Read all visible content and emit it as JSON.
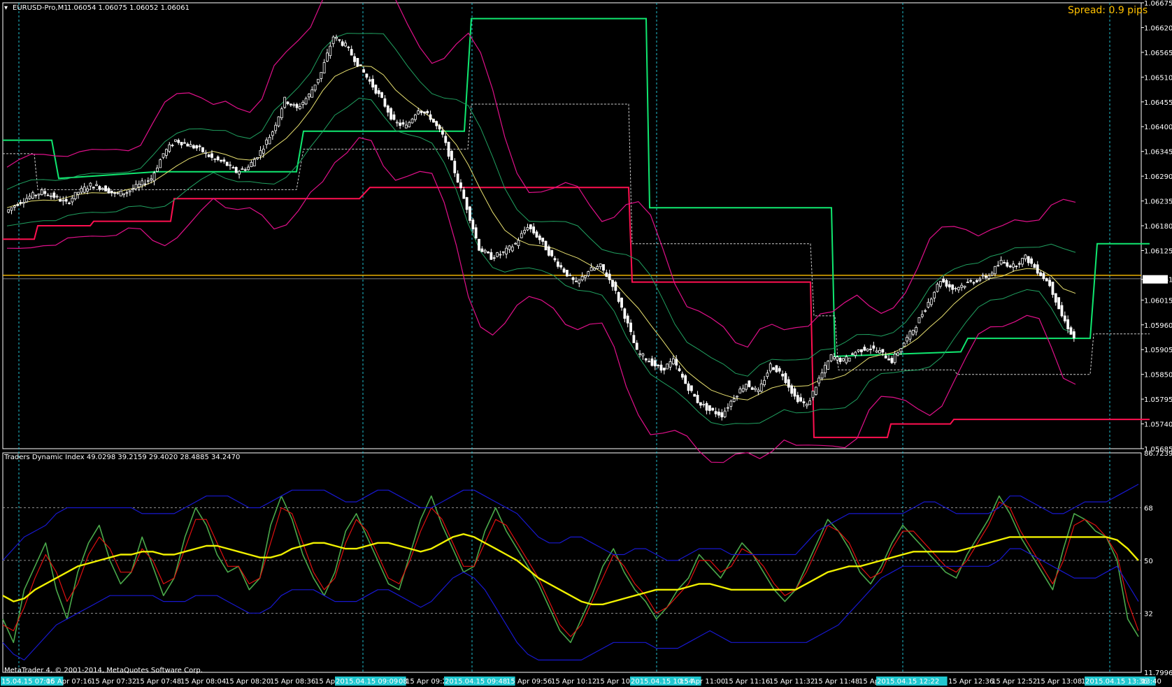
{
  "window": {
    "symbol_title": "EURUSD-Pro,M1",
    "ohlc": "1.06054 1.06075 1.06052 1.06061",
    "spread_label": "Spread: 0.9 pips",
    "copyright": "MetaTrader 4, © 2001-2014, MetaQuotes Software Corp."
  },
  "colors": {
    "background": "#000000",
    "candle": "#ffffff",
    "bb_outer": "#e0108a",
    "bb_mid": "#20a060",
    "ma_yellow": "#e8e070",
    "channel_green": "#10e870",
    "channel_red": "#ff1050",
    "tdi_price": "#4aa84a",
    "tdi_signal": "#e01010",
    "tdi_band": "#1818d0",
    "tdi_market_base": "#f0f000",
    "vline": "#20c0d0",
    "hline_price": "#ffc000",
    "time_highlight": "#20c8d0"
  },
  "chart_data": [
    {
      "type": "candlestick",
      "name_label": "EURUSD-Pro,M1",
      "ylim": [
        1.05685,
        1.06675
      ],
      "y_ticks": [
        "1.06675",
        "1.06620",
        "1.06565",
        "1.06510",
        "1.06455",
        "1.06400",
        "1.06345",
        "1.06290",
        "1.06235",
        "1.06180",
        "1.06125",
        "1.06061",
        "1.06015",
        "1.05960",
        "1.05905",
        "1.05850",
        "1.05795",
        "1.05740",
        "1.05685"
      ],
      "current_price": "1.06061",
      "price_line": 1.0607,
      "close_path": [
        [
          0,
          1.0621
        ],
        [
          12,
          1.0623
        ],
        [
          24,
          1.06245
        ],
        [
          36,
          1.06255
        ],
        [
          48,
          1.06245
        ],
        [
          60,
          1.0623
        ],
        [
          72,
          1.06255
        ],
        [
          84,
          1.0627
        ],
        [
          96,
          1.06265
        ],
        [
          108,
          1.0625
        ],
        [
          120,
          1.06255
        ],
        [
          132,
          1.0627
        ],
        [
          144,
          1.06285
        ],
        [
          156,
          1.0634
        ],
        [
          168,
          1.0637
        ],
        [
          180,
          1.0636
        ],
        [
          192,
          1.0635
        ],
        [
          204,
          1.0633
        ],
        [
          216,
          1.0632
        ],
        [
          228,
          1.063
        ],
        [
          240,
          1.0631
        ],
        [
          252,
          1.06345
        ],
        [
          264,
          1.0639
        ],
        [
          276,
          1.0646
        ],
        [
          288,
          1.0644
        ],
        [
          300,
          1.0647
        ],
        [
          312,
          1.0652
        ],
        [
          324,
          1.066
        ],
        [
          336,
          1.0658
        ],
        [
          348,
          1.0654
        ],
        [
          360,
          1.065
        ],
        [
          372,
          1.0646
        ],
        [
          384,
          1.0641
        ],
        [
          396,
          1.064
        ],
        [
          408,
          1.0644
        ],
        [
          420,
          1.0642
        ],
        [
          432,
          1.0638
        ],
        [
          444,
          1.063
        ],
        [
          456,
          1.0622
        ],
        [
          468,
          1.0613
        ],
        [
          480,
          1.0611
        ],
        [
          492,
          1.0612
        ],
        [
          504,
          1.0614
        ],
        [
          516,
          1.0618
        ],
        [
          528,
          1.0615
        ],
        [
          540,
          1.0611
        ],
        [
          552,
          1.0608
        ],
        [
          564,
          1.0605
        ],
        [
          576,
          1.0608
        ],
        [
          588,
          1.0609
        ],
        [
          600,
          1.0605
        ],
        [
          612,
          1.0598
        ],
        [
          624,
          1.059
        ],
        [
          636,
          1.0588
        ],
        [
          648,
          1.0586
        ],
        [
          660,
          1.0588
        ],
        [
          672,
          1.0583
        ],
        [
          684,
          1.0579
        ],
        [
          696,
          1.0577
        ],
        [
          708,
          1.0576
        ],
        [
          720,
          1.058
        ],
        [
          732,
          1.0583
        ],
        [
          744,
          1.0581
        ],
        [
          756,
          1.0587
        ],
        [
          768,
          1.0585
        ],
        [
          780,
          1.058
        ],
        [
          792,
          1.0578
        ],
        [
          804,
          1.0584
        ],
        [
          816,
          1.0589
        ],
        [
          828,
          1.0588
        ],
        [
          840,
          1.059
        ],
        [
          852,
          1.0591
        ],
        [
          864,
          1.059
        ],
        [
          876,
          1.0588
        ],
        [
          888,
          1.0592
        ],
        [
          900,
          1.0596
        ],
        [
          912,
          1.0601
        ],
        [
          924,
          1.0606
        ],
        [
          936,
          1.0604
        ],
        [
          948,
          1.0605
        ],
        [
          960,
          1.0606
        ],
        [
          972,
          1.0607
        ],
        [
          984,
          1.061
        ],
        [
          996,
          1.0609
        ],
        [
          1008,
          1.0611
        ],
        [
          1020,
          1.0608
        ],
        [
          1032,
          1.0605
        ],
        [
          1044,
          1.0598
        ],
        [
          1056,
          1.0593
        ]
      ],
      "x_count": 1056,
      "channel_upper": [
        [
          0,
          1.0637
        ],
        [
          70,
          1.0637
        ],
        [
          80,
          1.06285
        ],
        [
          220,
          1.063
        ],
        [
          420,
          1.063
        ],
        [
          430,
          1.0639
        ],
        [
          660,
          1.0639
        ],
        [
          670,
          1.0664
        ],
        [
          920,
          1.0664
        ],
        [
          925,
          1.0622
        ],
        [
          1185,
          1.0622
        ],
        [
          1190,
          1.0589
        ],
        [
          1370,
          1.059
        ],
        [
          1380,
          1.0593
        ],
        [
          1555,
          1.0593
        ],
        [
          1565,
          1.0614
        ],
        [
          1640,
          1.0614
        ]
      ],
      "channel_lower": [
        [
          0,
          1.0615
        ],
        [
          45,
          1.0615
        ],
        [
          50,
          1.0618
        ],
        [
          125,
          1.0618
        ],
        [
          130,
          1.0619
        ],
        [
          240,
          1.0619
        ],
        [
          245,
          1.0624
        ],
        [
          510,
          1.0624
        ],
        [
          525,
          1.06265
        ],
        [
          895,
          1.06265
        ],
        [
          900,
          1.06055
        ],
        [
          1155,
          1.06055
        ],
        [
          1160,
          1.0571
        ],
        [
          1265,
          1.0571
        ],
        [
          1270,
          1.0574
        ],
        [
          1355,
          1.0574
        ],
        [
          1360,
          1.0575
        ],
        [
          1640,
          1.0575
        ]
      ],
      "channel_mid": [
        [
          0,
          1.0634
        ],
        [
          45,
          1.0634
        ],
        [
          50,
          1.0626
        ],
        [
          220,
          1.0626
        ],
        [
          420,
          1.0626
        ],
        [
          430,
          1.0635
        ],
        [
          665,
          1.0635
        ],
        [
          670,
          1.0645
        ],
        [
          895,
          1.0645
        ],
        [
          900,
          1.0614
        ],
        [
          1155,
          1.0614
        ],
        [
          1160,
          1.0598
        ],
        [
          1190,
          1.0598
        ],
        [
          1195,
          1.0586
        ],
        [
          1360,
          1.0586
        ],
        [
          1365,
          1.0585
        ],
        [
          1555,
          1.0585
        ],
        [
          1560,
          1.0594
        ],
        [
          1640,
          1.0594
        ]
      ],
      "vertical_time_lines": [
        "15 Apr 07:06",
        "2015.04.15 09:09",
        "2015.04.15 09:48",
        "2015.04.15 10:54",
        "2015.04.15 12:22",
        "2015.04.15 13:36"
      ]
    },
    {
      "type": "line",
      "indicator_label": "Traders Dynamic Index 49.0298 39.2159 29.4020 28.4885 34.2470",
      "ylim": [
        11.7996,
        86.7239
      ],
      "y_ticks": [
        "86.7239",
        "68",
        "50",
        "32",
        "11.7996"
      ],
      "levels": [
        68,
        50,
        32
      ],
      "series": [
        {
          "role": "price_line",
          "values": [
            30,
            22,
            40,
            48,
            56,
            40,
            30,
            46,
            56,
            62,
            50,
            42,
            46,
            58,
            48,
            38,
            44,
            58,
            68,
            62,
            52,
            46,
            48,
            40,
            44,
            62,
            72,
            64,
            52,
            44,
            38,
            46,
            60,
            66,
            58,
            50,
            42,
            40,
            52,
            64,
            72,
            62,
            54,
            46,
            48,
            60,
            68,
            60,
            54,
            48,
            42,
            34,
            26,
            22,
            30,
            38,
            48,
            54,
            46,
            40,
            36,
            30,
            34,
            40,
            44,
            52,
            48,
            44,
            50,
            56,
            52,
            46,
            40,
            36,
            40,
            48,
            56,
            64,
            60,
            54,
            46,
            42,
            48,
            56,
            62,
            58,
            54,
            50,
            46,
            44,
            52,
            58,
            64,
            72,
            66,
            58,
            52,
            46,
            40,
            54,
            66,
            64,
            60,
            58,
            50,
            30,
            24
          ]
        },
        {
          "role": "signal_line",
          "values": [
            28,
            26,
            34,
            44,
            52,
            46,
            36,
            42,
            52,
            58,
            54,
            46,
            46,
            54,
            50,
            42,
            44,
            54,
            64,
            64,
            56,
            48,
            48,
            42,
            44,
            56,
            68,
            66,
            56,
            46,
            40,
            44,
            56,
            64,
            60,
            52,
            44,
            42,
            50,
            60,
            68,
            64,
            56,
            48,
            48,
            56,
            64,
            62,
            56,
            50,
            44,
            36,
            28,
            24,
            28,
            36,
            44,
            52,
            48,
            42,
            38,
            32,
            34,
            38,
            42,
            50,
            50,
            46,
            48,
            54,
            52,
            48,
            42,
            38,
            40,
            46,
            54,
            62,
            60,
            56,
            48,
            44,
            46,
            54,
            60,
            60,
            56,
            52,
            48,
            46,
            50,
            56,
            62,
            70,
            68,
            60,
            54,
            48,
            42,
            50,
            62,
            64,
            62,
            58,
            52,
            36,
            26
          ]
        },
        {
          "role": "market_base",
          "values": [
            38,
            36,
            37,
            40,
            42,
            44,
            46,
            48,
            49,
            50,
            51,
            52,
            52,
            53,
            53,
            52,
            52,
            53,
            54,
            55,
            55,
            54,
            53,
            52,
            51,
            51,
            52,
            54,
            55,
            56,
            56,
            55,
            54,
            54,
            55,
            56,
            56,
            55,
            54,
            53,
            54,
            56,
            58,
            59,
            58,
            56,
            54,
            52,
            50,
            47,
            44,
            42,
            40,
            38,
            36,
            35,
            35,
            36,
            37,
            38,
            39,
            40,
            40,
            40,
            41,
            42,
            42,
            41,
            40,
            40,
            40,
            40,
            40,
            40,
            40,
            42,
            44,
            46,
            47,
            48,
            48,
            49,
            50,
            51,
            52,
            53,
            53,
            53,
            53,
            53,
            54,
            55,
            56,
            57,
            58,
            58,
            58,
            58,
            58,
            58,
            58,
            58,
            58,
            58,
            57,
            54,
            50
          ]
        },
        {
          "role": "upper_band",
          "values": [
            50,
            54,
            58,
            60,
            62,
            66,
            68,
            68,
            68,
            68,
            68,
            68,
            68,
            66,
            66,
            66,
            66,
            68,
            70,
            72,
            72,
            72,
            70,
            68,
            68,
            70,
            72,
            74,
            74,
            74,
            74,
            72,
            70,
            70,
            72,
            74,
            74,
            72,
            70,
            68,
            68,
            70,
            72,
            74,
            74,
            72,
            70,
            68,
            66,
            62,
            58,
            56,
            56,
            58,
            58,
            56,
            54,
            52,
            52,
            54,
            54,
            52,
            50,
            50,
            52,
            54,
            54,
            54,
            52,
            52,
            52,
            52,
            52,
            52,
            52,
            56,
            60,
            62,
            64,
            66,
            66,
            66,
            66,
            66,
            66,
            68,
            70,
            70,
            68,
            66,
            66,
            66,
            66,
            68,
            72,
            72,
            70,
            68,
            66,
            66,
            68,
            70,
            70,
            70,
            72,
            74,
            76
          ]
        },
        {
          "role": "lower_band",
          "values": [
            22,
            18,
            16,
            20,
            24,
            28,
            30,
            32,
            34,
            36,
            38,
            38,
            38,
            38,
            38,
            36,
            36,
            36,
            38,
            38,
            38,
            36,
            34,
            32,
            32,
            34,
            38,
            40,
            40,
            40,
            38,
            36,
            36,
            36,
            38,
            40,
            40,
            38,
            36,
            34,
            36,
            40,
            44,
            46,
            44,
            40,
            34,
            28,
            22,
            18,
            16,
            16,
            16,
            16,
            16,
            18,
            20,
            22,
            22,
            22,
            22,
            20,
            20,
            20,
            22,
            24,
            26,
            24,
            22,
            22,
            22,
            22,
            22,
            22,
            22,
            22,
            24,
            26,
            28,
            32,
            36,
            40,
            44,
            46,
            48,
            48,
            48,
            48,
            48,
            48,
            48,
            48,
            48,
            50,
            54,
            54,
            52,
            50,
            48,
            46,
            44,
            44,
            44,
            46,
            48,
            42,
            36
          ]
        }
      ],
      "x_labels": [
        "15.04.15 07:06",
        "15 Apr 07:16",
        "15 Apr 07:32",
        "15 Apr 07:48",
        "15 Apr 08:04",
        "15 Apr 08:20",
        "15 Apr 08:36",
        "15 Apr",
        "2015.04.15 09:09",
        "08",
        "15 Apr 09:24",
        "2015.04.15 09:48",
        "15 Apr 09:56",
        "15 Apr 10:12",
        "15 Apr 10:28",
        "2015.04.15 10:54",
        "15 Apr 11:00",
        "15 Apr 11:16",
        "15 Apr 11:32",
        "15 Apr 11:48",
        "15 Apr",
        "2015.04.15 12:22",
        "15 Apr 12:36",
        "15 Apr 12:52",
        "15 Apr 13:08",
        "1",
        "2015.04.15 13:36",
        "13:40"
      ],
      "highlighted_x_labels": [
        "15.04.15 07:06",
        "2015.04.15 09:09",
        "2015.04.15 09:48",
        "2015.04.15 10:54",
        "2015.04.15 12:22",
        "2015.04.15 13:36"
      ]
    }
  ]
}
